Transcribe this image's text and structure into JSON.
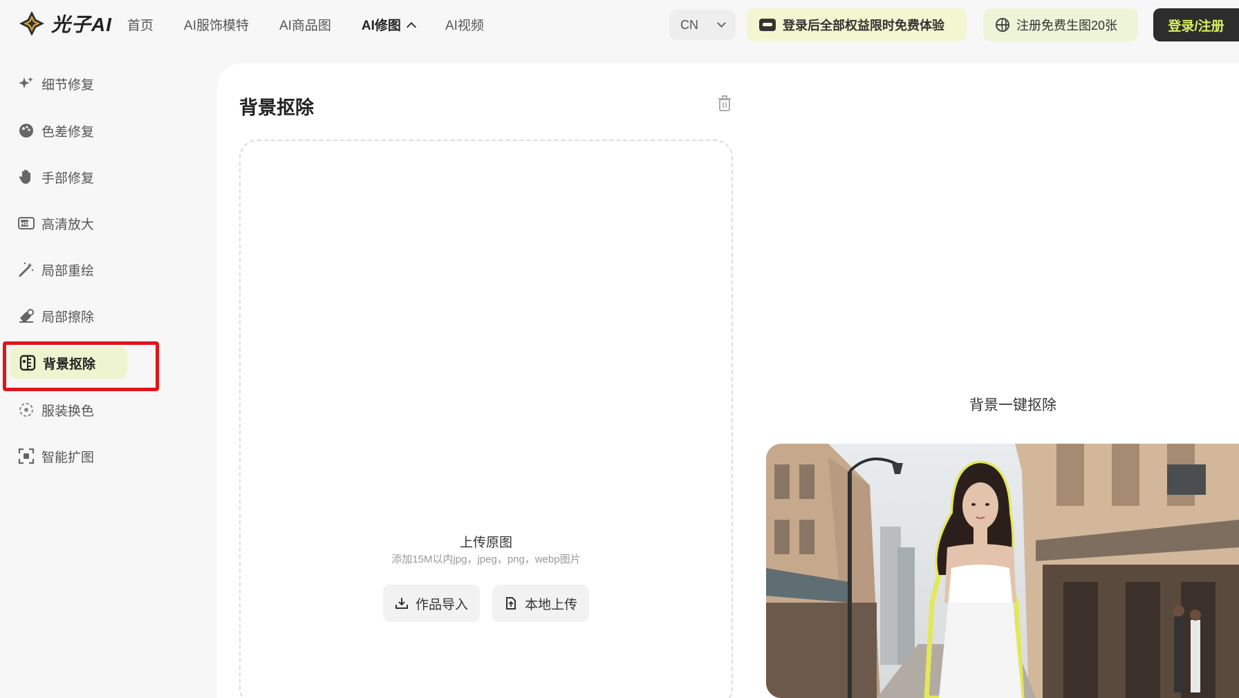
{
  "header": {
    "logo_text": "光子AI",
    "nav": [
      {
        "label": "首页"
      },
      {
        "label": "AI服饰模特"
      },
      {
        "label": "AI商品图"
      },
      {
        "label": "AI修图"
      },
      {
        "label": "AI视频"
      }
    ],
    "lang": "CN",
    "promo_login": "登录后全部权益限时免费体验",
    "promo_register": "注册免费生图20张",
    "login_label": "登录/注册"
  },
  "sidebar": {
    "items": [
      {
        "label": "细节修复"
      },
      {
        "label": "色差修复"
      },
      {
        "label": "手部修复"
      },
      {
        "label": "高清放大"
      },
      {
        "label": "局部重绘"
      },
      {
        "label": "局部擦除"
      },
      {
        "label": "背景抠除"
      },
      {
        "label": "服装换色"
      },
      {
        "label": "智能扩图"
      }
    ],
    "active_index": 6
  },
  "panel": {
    "title": "背景抠除",
    "upload_title": "上传原图",
    "upload_hint": "添加15M以内jpg，jpeg，png，webp图片",
    "import_label": "作品导入",
    "local_upload_label": "本地上传"
  },
  "demo": {
    "label": "背景一键抠除"
  },
  "colors": {
    "accent_bg": "#eef4cf",
    "login_bg": "#2d2d2d",
    "login_text": "#d9f061",
    "highlight": "#e0141b"
  }
}
